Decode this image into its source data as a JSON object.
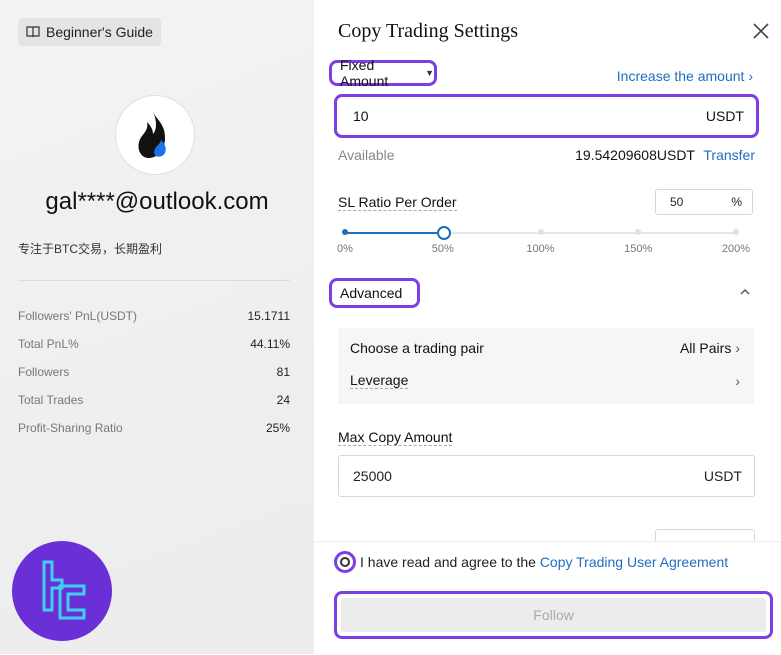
{
  "left": {
    "guide_label": "Beginner's Guide",
    "email": "gal****@outlook.com",
    "bio": "专注于BTC交易，长期盈利",
    "stats": [
      {
        "label": "Followers' PnL(USDT)",
        "value": "15.1711"
      },
      {
        "label": "Total PnL%",
        "value": "44.11%"
      },
      {
        "label": "Followers",
        "value": "81"
      },
      {
        "label": "Total Trades",
        "value": "24"
      },
      {
        "label": "Profit-Sharing Ratio",
        "value": "25%"
      }
    ]
  },
  "dialog": {
    "title": "Copy Trading Settings",
    "mode_label": "Fixed Amount",
    "increase_link": "Increase the amount",
    "amount_value": "10",
    "amount_unit": "USDT",
    "available_label": "Available",
    "available_value": "19.54209608USDT",
    "transfer_link": "Transfer",
    "sl_label": "SL Ratio Per Order",
    "sl_value": "50",
    "sl_unit": "%",
    "sl_slider": {
      "value_percent": 50,
      "ticks": [
        "0%",
        "50%",
        "100%",
        "150%",
        "200%"
      ]
    },
    "advanced_label": "Advanced",
    "pair_label": "Choose a trading pair",
    "pair_value": "All Pairs",
    "leverage_label": "Leverage",
    "max_copy_label": "Max Copy Amount",
    "max_copy_value": "25000",
    "max_copy_unit": "USDT",
    "agree_prefix": "I have read and agree to the ",
    "agree_link": "Copy Trading User Agreement",
    "follow_label": "Follow"
  },
  "colors": {
    "accent": "#1e6fbf",
    "highlight": "#7b3fe4",
    "badge": "#6b2fd8"
  }
}
